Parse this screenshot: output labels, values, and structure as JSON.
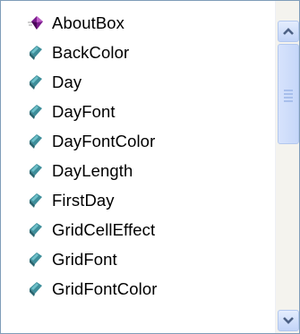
{
  "list": {
    "items": [
      {
        "label": "AboutBox",
        "icon": "method-icon"
      },
      {
        "label": "BackColor",
        "icon": "property-icon"
      },
      {
        "label": "Day",
        "icon": "property-icon"
      },
      {
        "label": "DayFont",
        "icon": "property-icon"
      },
      {
        "label": "DayFontColor",
        "icon": "property-icon"
      },
      {
        "label": "DayLength",
        "icon": "property-icon"
      },
      {
        "label": "FirstDay",
        "icon": "property-icon"
      },
      {
        "label": "GridCellEffect",
        "icon": "property-icon"
      },
      {
        "label": "GridFont",
        "icon": "property-icon"
      },
      {
        "label": "GridFontColor",
        "icon": "property-icon"
      }
    ]
  },
  "colors": {
    "method_icon": "#7a1b8c",
    "property_icon": "#3e8e9a",
    "border": "#7f9db9",
    "scroll_arrow": "#4d6185"
  }
}
